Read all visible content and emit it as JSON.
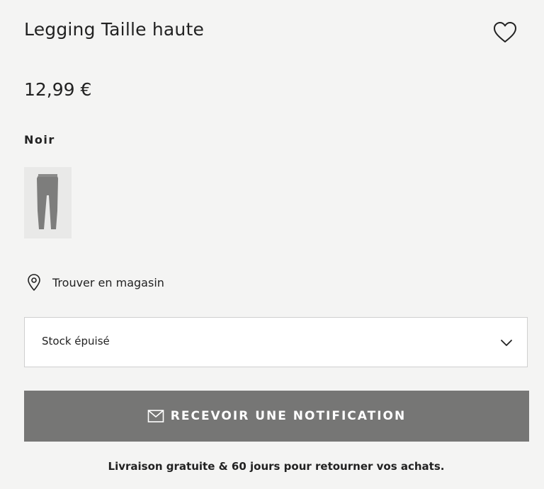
{
  "product": {
    "title": "Legging Taille haute",
    "price": "12,99 €",
    "color_name": "Noir",
    "swatch_icon": "leggings-thumbnail"
  },
  "wishlist": {
    "icon": "heart-outline-icon"
  },
  "store_locator": {
    "icon": "location-pin-icon",
    "label": "Trouver en magasin"
  },
  "size_select": {
    "selected_value": "Stock épuisé",
    "icon": "chevron-down-icon"
  },
  "notify_button": {
    "icon": "envelope-icon",
    "label": "RECEVOIR UNE NOTIFICATION"
  },
  "shipping_note": "Livraison gratuite & 60 jours pour retourner vos achats.",
  "colors": {
    "background": "#f4f4f3",
    "text": "#222222",
    "button": "#767675",
    "button_text": "#ffffff",
    "swatch_bg": "#e9e9e8",
    "select_border": "#cfcfcf"
  }
}
